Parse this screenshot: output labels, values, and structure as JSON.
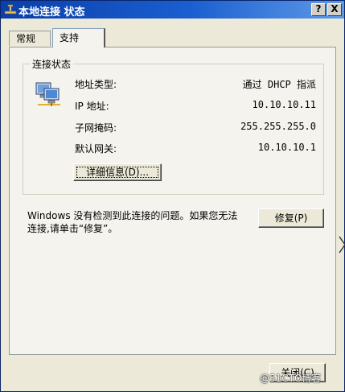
{
  "window": {
    "title": "本地连接 状态",
    "help_label": "?",
    "close_label": "X"
  },
  "tabs": [
    {
      "label": "常规",
      "active": false
    },
    {
      "label": "支持",
      "active": true
    }
  ],
  "connection_status": {
    "group_label": "连接状态",
    "icon": "network-connection-icon",
    "rows": [
      {
        "label": "地址类型:",
        "value": "通过 DHCP 指派"
      },
      {
        "label": "IP 地址:",
        "value": "10.10.10.11"
      },
      {
        "label": "子网掩码:",
        "value": "255.255.255.0"
      },
      {
        "label": "默认网关:",
        "value": "10.10.10.1"
      }
    ],
    "details_button": "详细信息(D)..."
  },
  "repair": {
    "message": "Windows 没有检测到此连接的问题。如果您无法连接,请单击“修复”。",
    "button": "修复(P)"
  },
  "footer": {
    "close_button": "关闭(C)"
  },
  "watermark": "@51CTO博客",
  "colors": {
    "titlebar": "#0a3fa8",
    "face": "#ece9d8",
    "panel": "#f4f3ee"
  }
}
